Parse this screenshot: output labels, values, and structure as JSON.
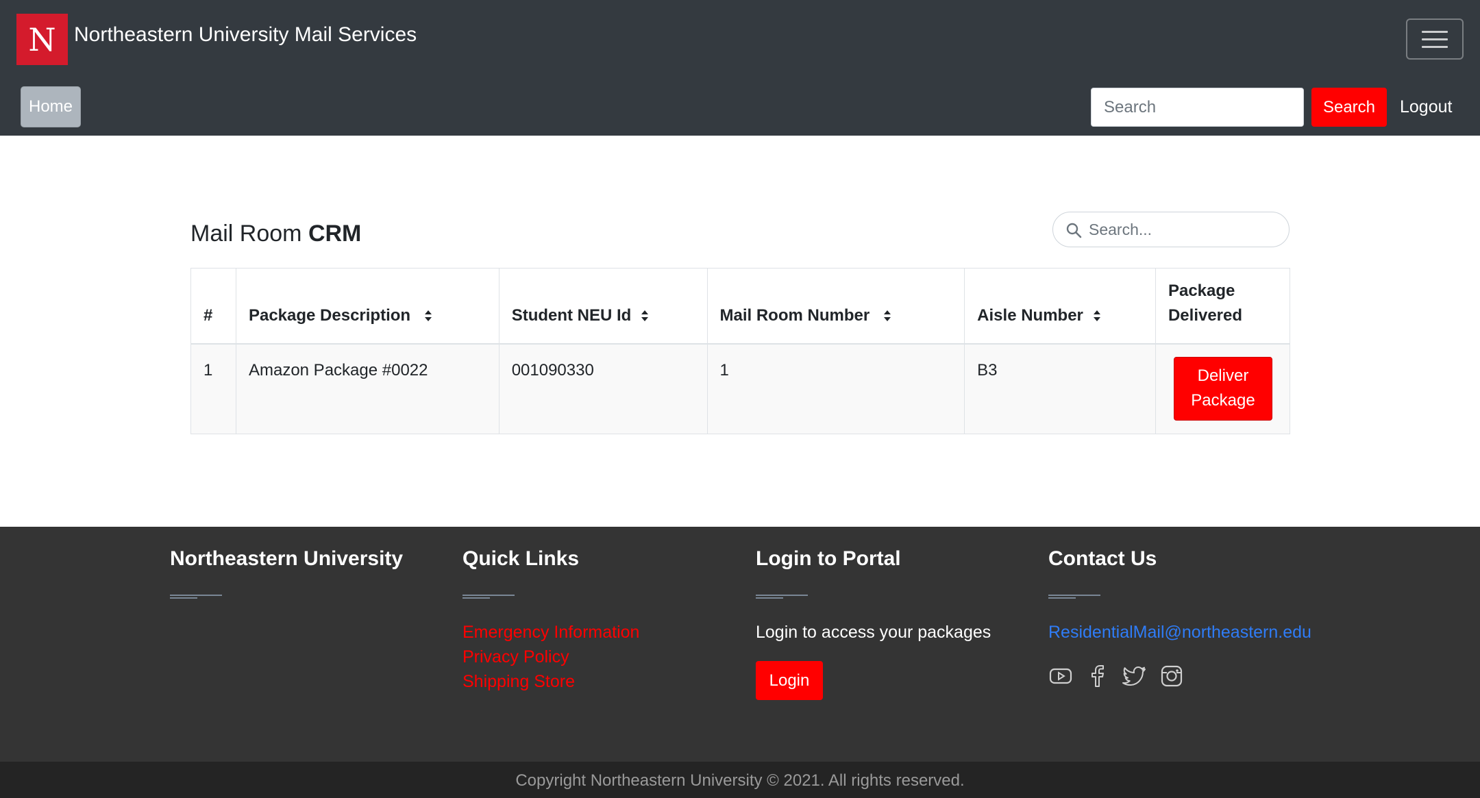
{
  "brand": {
    "logo_letter": "N",
    "title": "Northeastern University Mail Services"
  },
  "nav": {
    "home_label": "Home",
    "search_placeholder": "Search",
    "search_button": "Search",
    "logout_label": "Logout"
  },
  "main": {
    "title_prefix": "Mail Room ",
    "title_bold": "CRM",
    "search_placeholder": "Search..."
  },
  "table": {
    "headers": {
      "index": "#",
      "description": "Package Description",
      "student_id": "Student NEU Id",
      "mail_room": "Mail Room Number",
      "aisle": "Aisle Number",
      "delivered_line1": "Package",
      "delivered_line2": "Delivered"
    },
    "rows": [
      {
        "index": "1",
        "description": "Amazon Package #0022",
        "student_id": "001090330",
        "mail_room": "1",
        "aisle": "B3",
        "action_line1": "Deliver",
        "action_line2": "Package"
      }
    ]
  },
  "footer": {
    "col1": {
      "heading": "Northeastern University"
    },
    "col2": {
      "heading": "Quick Links",
      "links": [
        "Emergency Information",
        "Privacy Policy",
        "Shipping Store"
      ]
    },
    "col3": {
      "heading": "Login to Portal",
      "text": "Login to access your packages",
      "button": "Login"
    },
    "col4": {
      "heading": "Contact Us",
      "email": "ResidentialMail@northeastern.edu",
      "social_icons": [
        "youtube-icon",
        "facebook-icon",
        "twitter-icon",
        "instagram-icon"
      ]
    },
    "copyright": "Copyright Northeastern University © 2021. All rights reserved."
  },
  "colors": {
    "navbar_bg": "#343a40",
    "brand_red": "#d41b2c",
    "accent_red": "#ff0000",
    "footer_bg": "#343434",
    "copyright_bg": "#242424",
    "email_blue": "#2f7cf6"
  }
}
